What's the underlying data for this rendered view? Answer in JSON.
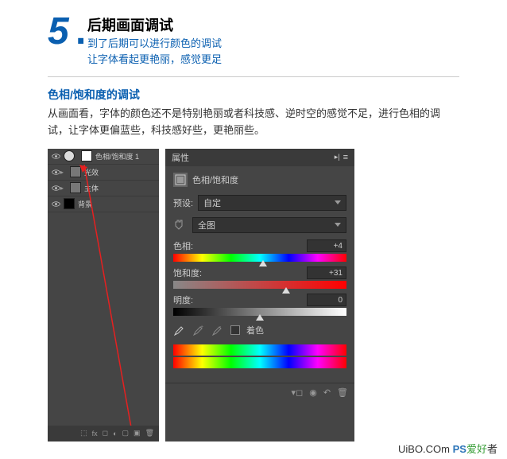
{
  "step": {
    "number": "5",
    "dot": ".",
    "title": "后期画面调试",
    "sub1": "到了后期可以进行颜色的调试",
    "sub2": "让字体看起更艳丽，感觉更足"
  },
  "section": {
    "title": "色相/饱和度的调试",
    "desc": "从画面看，字体的颜色还不是特别艳丽或者科技感、逆时空的感觉不足，进行色相的调试，让字体更偏蓝些，科技感好些，更艳丽些。"
  },
  "layers": {
    "items": [
      {
        "name": "色相/饱和度 1"
      },
      {
        "name": "光效"
      },
      {
        "name": "主体"
      },
      {
        "name": "背景"
      }
    ]
  },
  "props": {
    "tab": "属性",
    "title": "色相/饱和度",
    "preset_label": "预设:",
    "preset_value": "自定",
    "channel_value": "全图",
    "hue": {
      "label": "色相:",
      "value": "+4",
      "pos": 52
    },
    "saturation": {
      "label": "饱和度:",
      "value": "+31",
      "pos": 65
    },
    "lightness": {
      "label": "明度:",
      "value": "0",
      "pos": 50
    },
    "colorize": "着色"
  },
  "watermark": {
    "url": "UiBO.COm",
    "ps": "PS",
    "text": "爱好",
    "suffix": "者"
  }
}
